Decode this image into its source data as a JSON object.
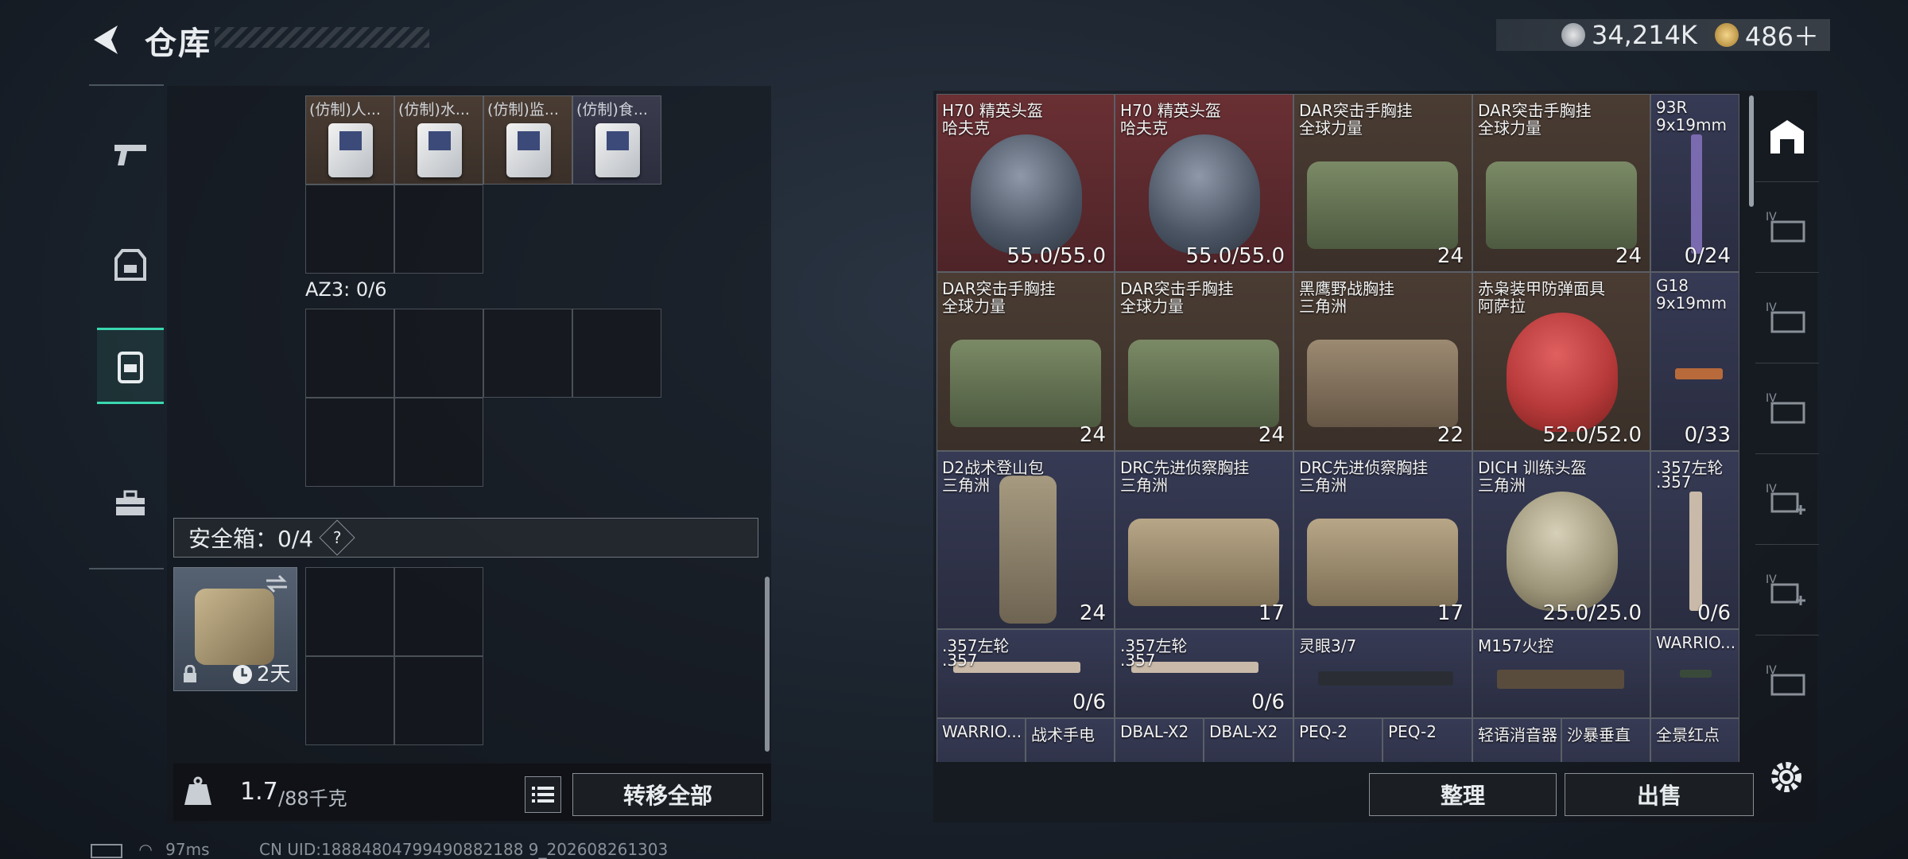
{
  "header": {
    "title": "仓库",
    "back_icon": "back-arrow-icon"
  },
  "currency": {
    "silver": "34,214K",
    "gold": "486＋"
  },
  "left_nav": [
    "pistol-icon",
    "armor-vest-icon",
    "backpack-icon",
    "toolbox-icon"
  ],
  "pockets": [
    "(仿制)人...",
    "(仿制)水...",
    "(仿制)监...",
    "(仿制)食..."
  ],
  "backpack_label": "AZ3: 0/6",
  "safe": {
    "label": "安全箱：0/4",
    "help": "?",
    "timer": "2天"
  },
  "weight": {
    "current": "1.7",
    "max": "/88千克"
  },
  "buttons": {
    "transfer_all": "转移全部",
    "sort": "整理",
    "sell": "出售"
  },
  "items": [
    {
      "n1": "H70 精英头盔",
      "n2": "哈夫克",
      "val": "55.0/55.0"
    },
    {
      "n1": "H70 精英头盔",
      "n2": "哈夫克",
      "val": "55.0/55.0"
    },
    {
      "n1": "DAR突击手胸挂",
      "n2": "全球力量",
      "val": "24"
    },
    {
      "n1": "DAR突击手胸挂",
      "n2": "全球力量",
      "val": "24"
    },
    {
      "n1": "93R",
      "n2": "9x19mm",
      "val": "0/24"
    },
    {
      "n1": "DAR突击手胸挂",
      "n2": "全球力量",
      "val": "24"
    },
    {
      "n1": "DAR突击手胸挂",
      "n2": "全球力量",
      "val": "24"
    },
    {
      "n1": "黑鹰野战胸挂",
      "n2": "三角洲",
      "val": "22"
    },
    {
      "n1": "赤枭装甲防弹面具",
      "n2": "阿萨拉",
      "val": "52.0/52.0"
    },
    {
      "n1": "G18",
      "n2": "9x19mm",
      "val": "0/33"
    },
    {
      "n1": "D2战术登山包",
      "n2": "三角洲",
      "val": "24"
    },
    {
      "n1": "DRC先进侦察胸挂",
      "n2": "三角洲",
      "val": "17"
    },
    {
      "n1": "DRC先进侦察胸挂",
      "n2": "三角洲",
      "val": "17"
    },
    {
      "n1": "DICH 训练头盔",
      "n2": "三角洲",
      "val": "25.0/25.0"
    },
    {
      "n1": ".357左轮",
      "n2": ".357",
      "val": "0/6"
    },
    {
      "n1": ".357左轮",
      "n2": ".357",
      "val": "0/6"
    },
    {
      "n1": ".357左轮",
      "n2": ".357",
      "val": "0/6"
    },
    {
      "n1": "灵眼3/7",
      "n2": "",
      "val": ""
    },
    {
      "n1": "M157火控",
      "n2": "",
      "val": ""
    },
    {
      "n1": "WARRIO...",
      "n2": "",
      "val": ""
    },
    {
      "n1": "WARRIO...",
      "n2": "",
      "val": ""
    },
    {
      "n1": "战术手电",
      "n2": "",
      "val": ""
    },
    {
      "n1": "DBAL-X2",
      "n2": "",
      "val": ""
    },
    {
      "n1": "DBAL-X2",
      "n2": "",
      "val": ""
    },
    {
      "n1": "PEQ-2",
      "n2": "",
      "val": ""
    },
    {
      "n1": "PEQ-2",
      "n2": "",
      "val": ""
    },
    {
      "n1": "轻语消音器",
      "n2": "",
      "val": ""
    },
    {
      "n1": "沙暴垂直",
      "n2": "",
      "val": ""
    },
    {
      "n1": "全景红点",
      "n2": "",
      "val": ""
    }
  ],
  "right_tabs": [
    "home-shelf-icon",
    "storage-IV-icon",
    "storage-IV-icon",
    "storage-IV-icon",
    "storage-IV-add-icon",
    "storage-IV-add-icon",
    "storage-IV-icon"
  ],
  "status": {
    "ping": "97ms",
    "uid": "CN UID:18884804799490882188 9_202608261303"
  }
}
